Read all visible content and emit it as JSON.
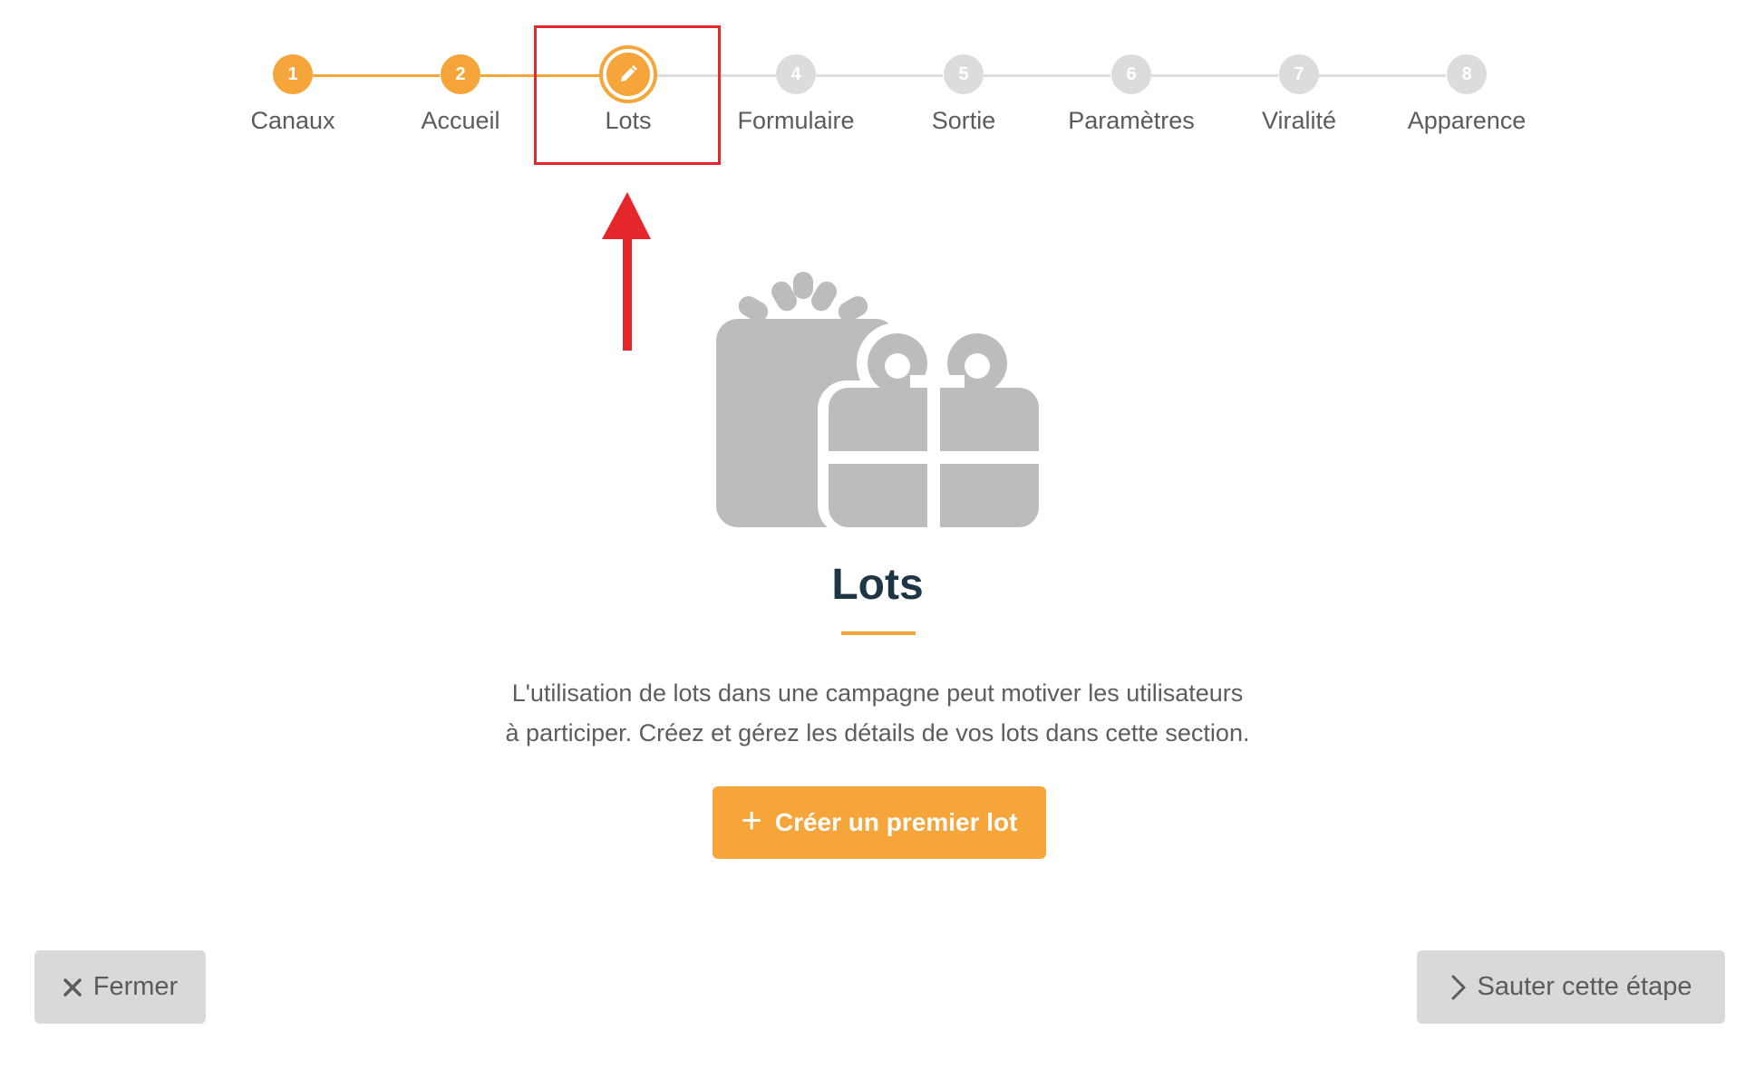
{
  "stepper": {
    "steps": [
      {
        "number": "1",
        "label": "Canaux",
        "state": "done"
      },
      {
        "number": "2",
        "label": "Accueil",
        "state": "done"
      },
      {
        "number": "",
        "label": "Lots",
        "state": "current",
        "icon": "pencil-icon"
      },
      {
        "number": "4",
        "label": "Formulaire",
        "state": "todo"
      },
      {
        "number": "5",
        "label": "Sortie",
        "state": "todo"
      },
      {
        "number": "6",
        "label": "Paramètres",
        "state": "todo"
      },
      {
        "number": "7",
        "label": "Viralité",
        "state": "todo"
      },
      {
        "number": "8",
        "label": "Apparence",
        "state": "todo"
      }
    ]
  },
  "main": {
    "icon": "gifts-icon",
    "title": "Lots",
    "description_line1": "L'utilisation de lots dans une campagne peut motiver les utilisateurs",
    "description_line2": "à participer. Créez et gérez les détails de vos lots dans cette section.",
    "cta_label": "Créer un premier lot",
    "cta_icon": "plus-icon"
  },
  "footer": {
    "close_label": "Fermer",
    "close_icon": "close-icon",
    "skip_label": "Sauter cette étape",
    "skip_icon": "chevron-right-icon"
  },
  "colors": {
    "accent": "#f5a53a",
    "inactive": "#dcdcdc",
    "title": "#1e3545",
    "annotation": "#e5262a"
  }
}
